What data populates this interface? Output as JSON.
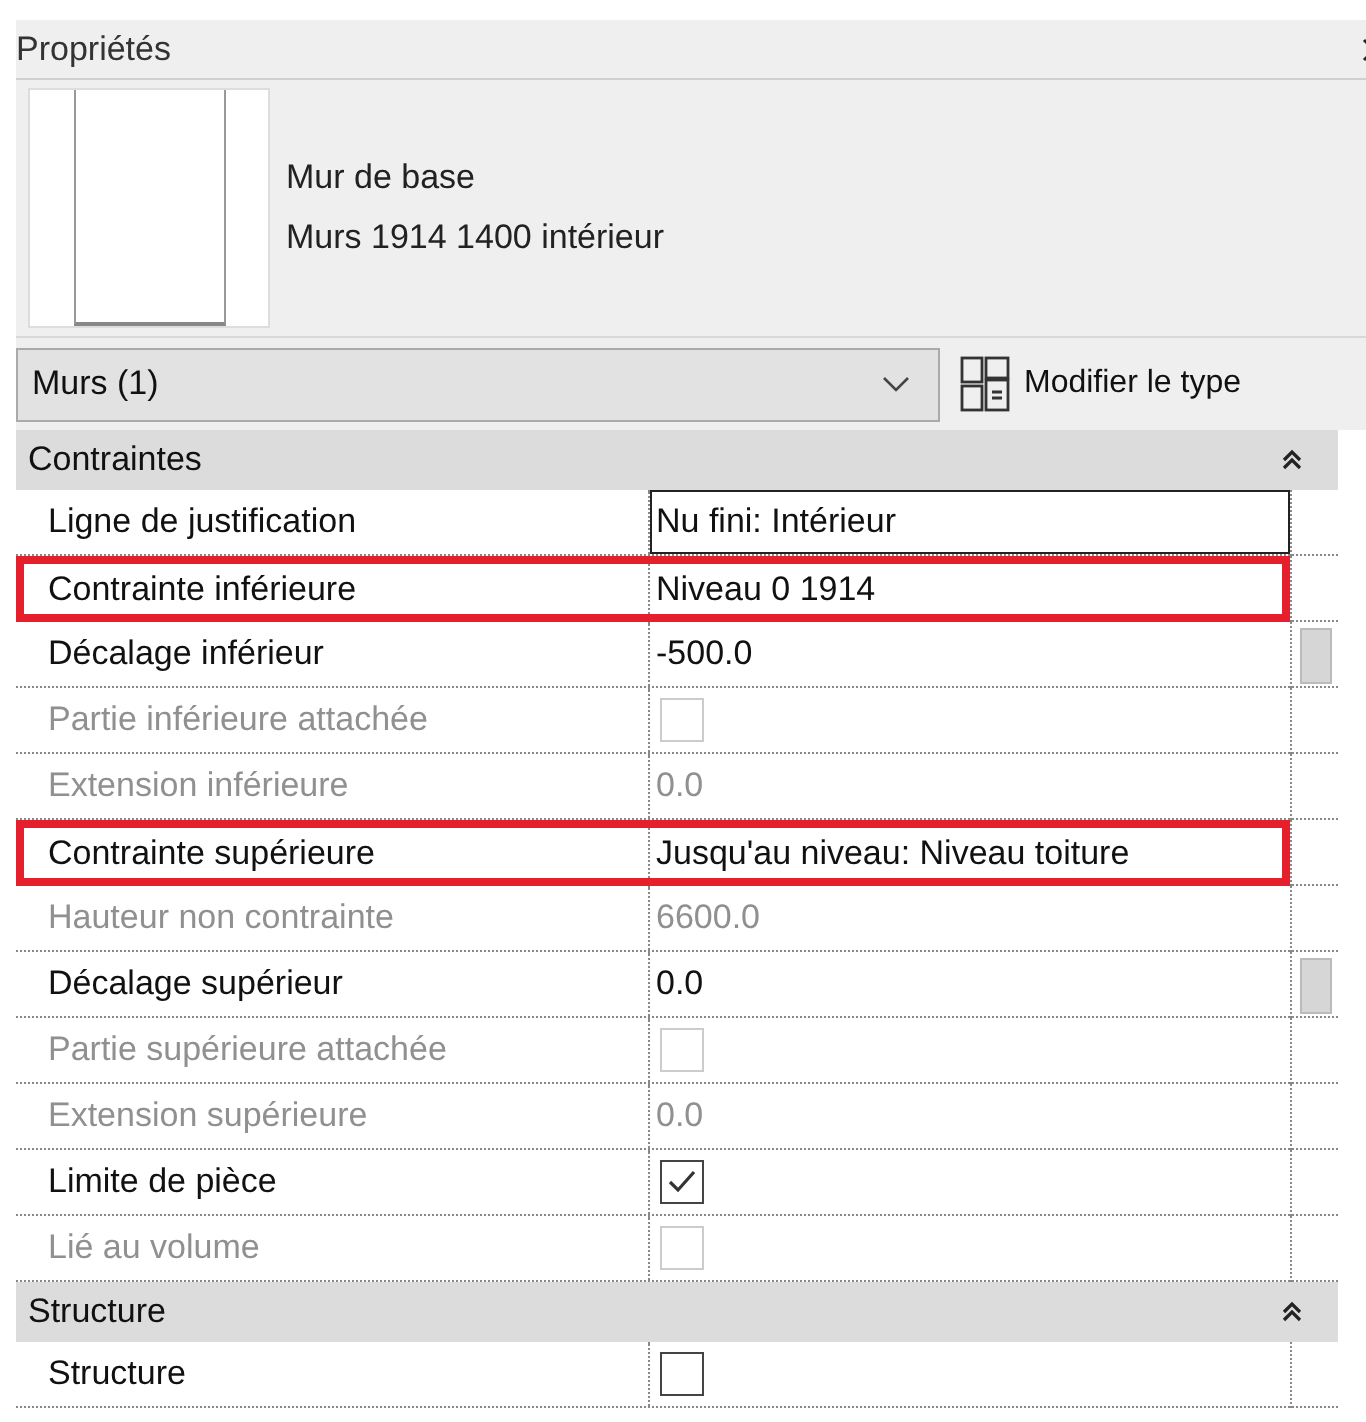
{
  "panel": {
    "title": "Propriétés"
  },
  "type_preview": {
    "family": "Mur de base",
    "type": "Murs 1914 1400 intérieur"
  },
  "selector": {
    "value": "Murs (1)",
    "edit_type_label": "Modifier le type"
  },
  "sections": [
    {
      "title": "Contraintes",
      "expanded": true,
      "rows": [
        {
          "label": "Ligne de justification",
          "kind": "text",
          "value": "Nu fini: Intérieur",
          "disabled": false,
          "highlighted": false,
          "focused": true,
          "scroll_handle": false
        },
        {
          "label": "Contrainte inférieure",
          "kind": "text",
          "value": "Niveau 0 1914",
          "disabled": false,
          "highlighted": true,
          "focused": false,
          "scroll_handle": false
        },
        {
          "label": "Décalage inférieur",
          "kind": "text",
          "value": "-500.0",
          "disabled": false,
          "highlighted": false,
          "focused": false,
          "scroll_handle": true
        },
        {
          "label": "Partie inférieure attachée",
          "kind": "checkbox",
          "checked": false,
          "disabled": true,
          "highlighted": false,
          "focused": false,
          "scroll_handle": false
        },
        {
          "label": "Extension inférieure",
          "kind": "text",
          "value": "0.0",
          "disabled": true,
          "highlighted": false,
          "focused": false,
          "scroll_handle": false
        },
        {
          "label": "Contrainte supérieure",
          "kind": "text",
          "value": "Jusqu'au niveau: Niveau toiture",
          "disabled": false,
          "highlighted": true,
          "focused": false,
          "scroll_handle": false
        },
        {
          "label": "Hauteur non contrainte",
          "kind": "text",
          "value": "6600.0",
          "disabled": true,
          "highlighted": false,
          "focused": false,
          "scroll_handle": false
        },
        {
          "label": "Décalage supérieur",
          "kind": "text",
          "value": "0.0",
          "disabled": false,
          "highlighted": false,
          "focused": false,
          "scroll_handle": true
        },
        {
          "label": "Partie supérieure attachée",
          "kind": "checkbox",
          "checked": false,
          "disabled": true,
          "highlighted": false,
          "focused": false,
          "scroll_handle": false
        },
        {
          "label": "Extension supérieure",
          "kind": "text",
          "value": "0.0",
          "disabled": true,
          "highlighted": false,
          "focused": false,
          "scroll_handle": false
        },
        {
          "label": "Limite de pièce",
          "kind": "checkbox",
          "checked": true,
          "disabled": false,
          "highlighted": false,
          "focused": false,
          "scroll_handle": false
        },
        {
          "label": "Lié au volume",
          "kind": "checkbox",
          "checked": false,
          "disabled": true,
          "highlighted": false,
          "focused": false,
          "scroll_handle": false
        }
      ]
    },
    {
      "title": "Structure",
      "expanded": true,
      "rows": [
        {
          "label": "Structure",
          "kind": "checkbox",
          "checked": false,
          "disabled": false,
          "highlighted": false,
          "focused": false,
          "scroll_handle": false
        }
      ]
    }
  ]
}
